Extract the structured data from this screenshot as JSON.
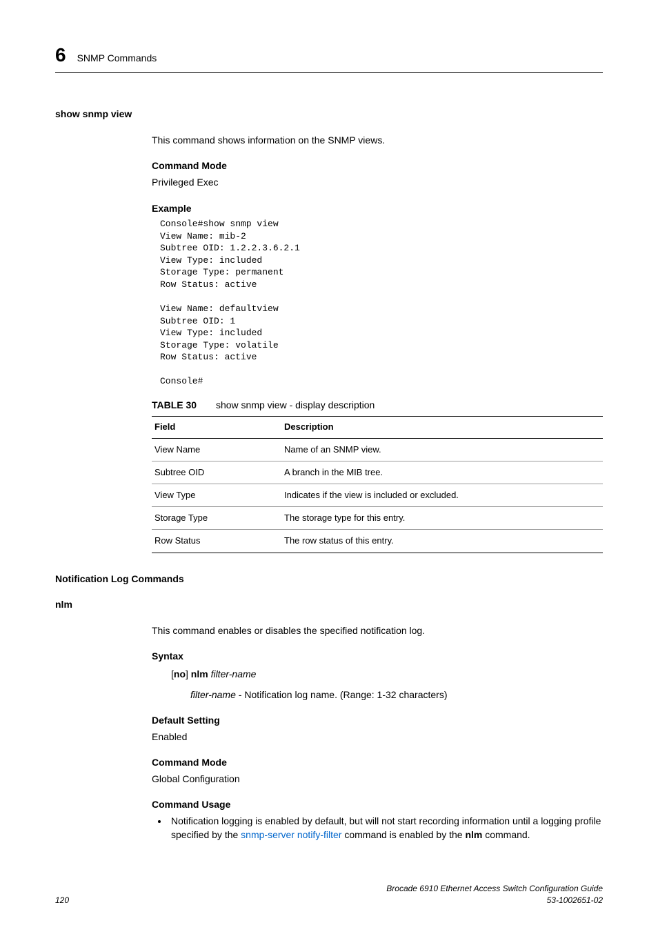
{
  "header": {
    "chapter_num": "6",
    "chapter_title": "SNMP Commands"
  },
  "section1": {
    "heading": "show snmp view",
    "intro": "This command shows information on the SNMP views.",
    "cmd_mode_label": "Command Mode",
    "cmd_mode": "Privileged Exec",
    "example_label": "Example",
    "example_code": "Console#show snmp view\nView Name: mib-2\nSubtree OID: 1.2.2.3.6.2.1\nView Type: included\nStorage Type: permanent\nRow Status: active\n\nView Name: defaultview\nSubtree OID: 1\nView Type: included\nStorage Type: volatile\nRow Status: active\n\nConsole#",
    "table": {
      "label": "TABLE 30",
      "caption": "show snmp view - display description",
      "col1": "Field",
      "col2": "Description",
      "rows": [
        {
          "f": "View Name",
          "d": "Name of an SNMP view."
        },
        {
          "f": "Subtree OID",
          "d": "A branch in the MIB tree."
        },
        {
          "f": "View Type",
          "d": "Indicates if the view is included or excluded."
        },
        {
          "f": "Storage Type",
          "d": "The storage type for this entry."
        },
        {
          "f": "Row Status",
          "d": "The row status of this entry."
        }
      ]
    }
  },
  "section2": {
    "heading": "Notification Log Commands",
    "sub_heading": "nlm",
    "intro": "This command enables or disables the specified notification log.",
    "syntax_label": "Syntax",
    "syntax_no": "no",
    "syntax_cmd": "nlm",
    "syntax_param": "filter-name",
    "syntax_param_desc_name": "filter-name",
    "syntax_param_desc_text": " - Notification log name. (Range: 1-32 characters)",
    "default_label": "Default Setting",
    "default_value": "Enabled",
    "cmd_mode_label": "Command Mode",
    "cmd_mode": "Global Configuration",
    "usage_label": "Command Usage",
    "usage_pre": "Notification logging is enabled by default, but will not start recording information until a logging profile specified by the ",
    "usage_link": "snmp-server notify-filter",
    "usage_mid": " command is enabled by the ",
    "usage_bold": "nlm",
    "usage_post": " command."
  },
  "footer": {
    "page": "120",
    "doc_title": "Brocade 6910 Ethernet Access Switch Configuration Guide",
    "doc_num": "53-1002651-02"
  }
}
